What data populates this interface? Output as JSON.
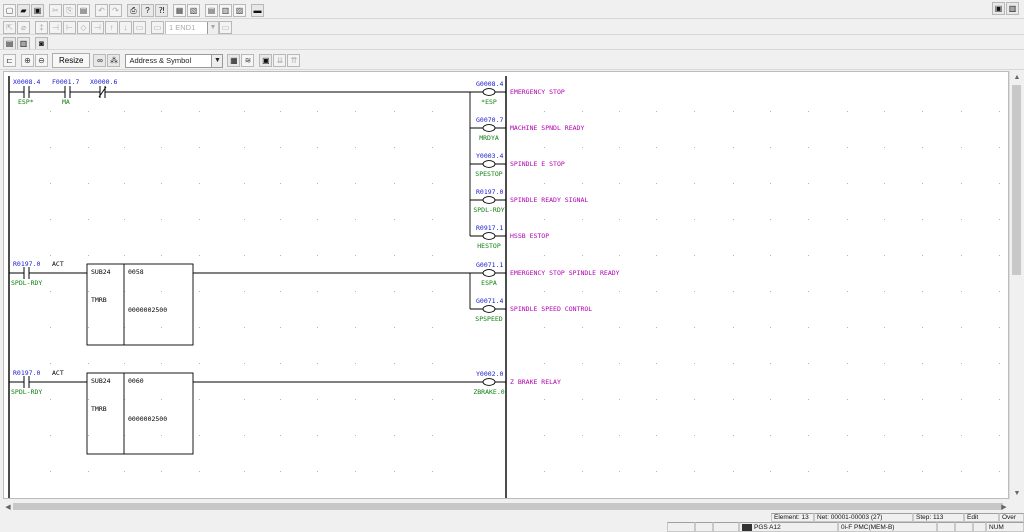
{
  "toolbar1": {
    "icons": [
      "new-icon",
      "open-icon",
      "save-icon",
      "cut-icon",
      "copy-icon",
      "paste-icon",
      "undo-icon",
      "redo-icon",
      "print-icon",
      "find-icon",
      "help-icon",
      "view-a-icon",
      "view-b-icon",
      "view-c-icon",
      "view-d-icon",
      "view-e-icon",
      "view-f-icon"
    ]
  },
  "toolbar2": {
    "glyphs": [
      "⇱",
      "⌀",
      "‡",
      "⊣",
      "⊢",
      "◇",
      "⊣",
      "↑",
      "↓",
      "▭",
      "▭"
    ],
    "net_combo": "1   END1"
  },
  "toolbar3": {
    "glyphs": [
      "▤",
      "▥",
      "◙"
    ]
  },
  "toolbar4": {
    "resize_label": "Resize",
    "display_mode": "Address & Symbol"
  },
  "ladder": {
    "rung1": {
      "contacts": [
        {
          "address": "X0008.4",
          "symbol": "ESP*",
          "type": "NO"
        },
        {
          "address": "F0001.7",
          "symbol": "MA",
          "type": "NO"
        },
        {
          "address": "X0000.6",
          "symbol": "",
          "type": "NC"
        }
      ],
      "coils": [
        {
          "address": "G0008.4",
          "symbol": "*ESP",
          "comment": "EMERGENCY STOP"
        },
        {
          "address": "G0070.7",
          "symbol": "MRDYA",
          "comment": "MACHINE SPNDL READY"
        },
        {
          "address": "Y0003.4",
          "symbol": "SPESTOP",
          "comment": "SPINDLE E STOP"
        },
        {
          "address": "R0197.0",
          "symbol": "SPDL-RDY",
          "comment": "SPINDLE READY SIGNAL"
        },
        {
          "address": "R0917.1",
          "symbol": "HESTOP",
          "comment": "HSSB ESTOP"
        }
      ]
    },
    "rung2": {
      "contact": {
        "address": "R0197.0",
        "symbol": "SPDL-RDY"
      },
      "act_label": "ACT",
      "block": {
        "name": "SUB24",
        "type": "TMRB",
        "number": "0058",
        "preset": "0000002500"
      },
      "coils": [
        {
          "address": "G0071.1",
          "symbol": "ESPA",
          "comment": "EMERGENCY STOP SPINDLE READY"
        },
        {
          "address": "G0071.4",
          "symbol": "SPSPEED",
          "comment": "SPINDLE SPEED CONTROL"
        }
      ]
    },
    "rung3": {
      "contact": {
        "address": "R0197.0",
        "symbol": "SPDL-RDY"
      },
      "act_label": "ACT",
      "block": {
        "name": "SUB24",
        "type": "TMRB",
        "number": "0060",
        "preset": "0000002500"
      },
      "coils": [
        {
          "address": "Y0002.0",
          "symbol": "ZBRAKE.0",
          "comment": "Z BRAKE RELAY"
        }
      ]
    }
  },
  "status": {
    "element": "Element: 13",
    "net": "Net: 00001-00003 (27)",
    "step": "Step: 113",
    "mode": "Edit",
    "insert": "Over",
    "program": "PGS A12",
    "pmc": "0i-F PMC(MEM-B)",
    "num": "NUM"
  },
  "colors": {
    "address": "#1a1ad0",
    "symbol": "#108010",
    "comment": "#b000b0",
    "line": "#000000",
    "dot": "#b4b4b4"
  }
}
